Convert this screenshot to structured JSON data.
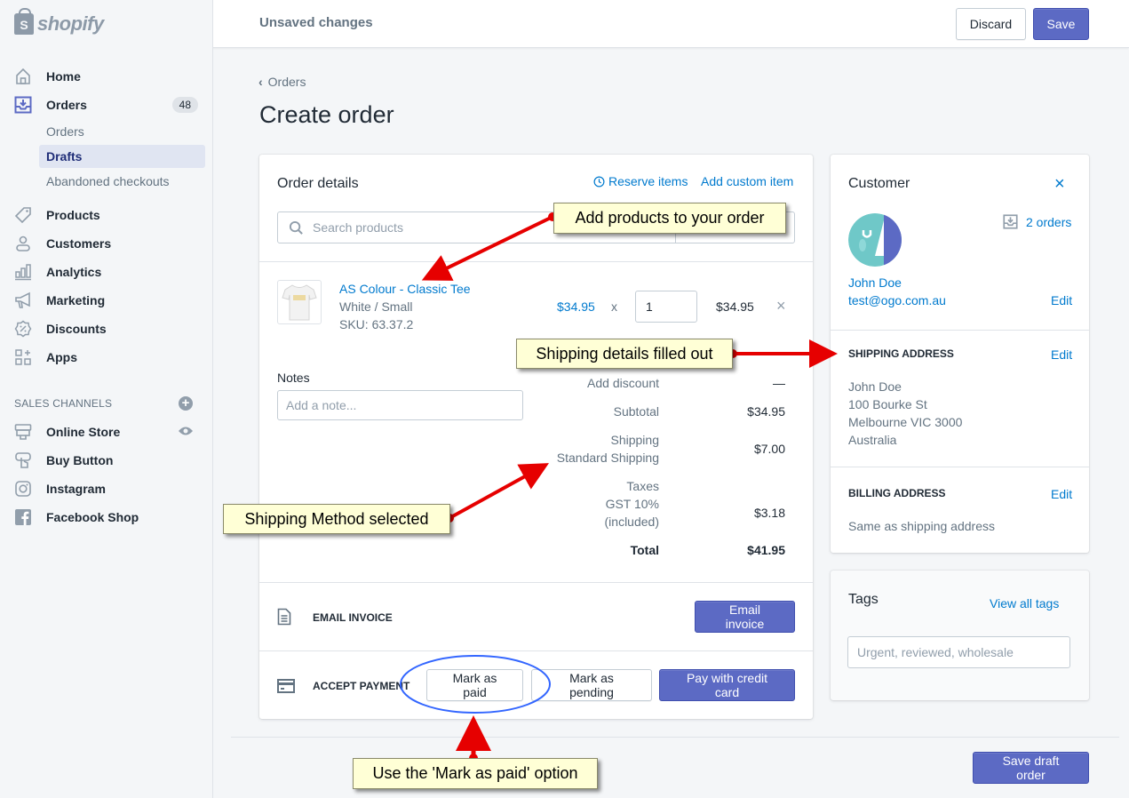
{
  "topbar": {
    "logo_text": "shopify",
    "status": "Unsaved changes",
    "discard_label": "Discard",
    "save_label": "Save"
  },
  "sidebar": {
    "items": [
      {
        "label": "Home",
        "icon": "home-icon"
      },
      {
        "label": "Orders",
        "icon": "orders-icon",
        "badge": "48"
      },
      {
        "label": "Products",
        "icon": "tag-icon"
      },
      {
        "label": "Customers",
        "icon": "person-icon"
      },
      {
        "label": "Analytics",
        "icon": "bar-chart-icon"
      },
      {
        "label": "Marketing",
        "icon": "megaphone-icon"
      },
      {
        "label": "Discounts",
        "icon": "discount-icon"
      },
      {
        "label": "Apps",
        "icon": "apps-icon"
      }
    ],
    "orders_sub": [
      "Orders",
      "Drafts",
      "Abandoned checkouts"
    ],
    "active_sub": "Drafts",
    "sales_channels_label": "SALES CHANNELS",
    "channels": [
      {
        "label": "Online Store",
        "icon": "store-icon"
      },
      {
        "label": "Buy Button",
        "icon": "buy-button-icon"
      },
      {
        "label": "Instagram",
        "icon": "instagram-icon"
      },
      {
        "label": "Facebook Shop",
        "icon": "facebook-icon"
      }
    ]
  },
  "main": {
    "breadcrumb": "Orders",
    "title": "Create order",
    "order_details": {
      "title": "Order details",
      "reserve_items": "Reserve items",
      "add_custom_item": "Add custom item",
      "search_placeholder": "Search products",
      "product": {
        "name": "AS Colour - Classic Tee",
        "variant": "White / Small",
        "sku": "SKU: 63.37.2",
        "price": "$34.95",
        "multiply": "x",
        "quantity": "1",
        "line_total": "$34.95"
      },
      "notes_label": "Notes",
      "notes_placeholder": "Add a note...",
      "summary": {
        "add_discount": "Add discount",
        "discount_value": "—",
        "subtotal_label": "Subtotal",
        "subtotal_value": "$34.95",
        "shipping_label": "Shipping",
        "shipping_method": "Standard Shipping",
        "shipping_value": "$7.00",
        "taxes_label": "Taxes",
        "tax_name": "GST 10%",
        "tax_note": "(included)",
        "tax_value": "$3.18",
        "total_label": "Total",
        "total_value": "$41.95"
      },
      "email_invoice_label": "EMAIL INVOICE",
      "email_invoice_button": "Email invoice",
      "accept_payment_label": "ACCEPT PAYMENT",
      "mark_paid_button": "Mark as paid",
      "mark_pending_button": "Mark as pending",
      "pay_card_button": "Pay with credit card"
    },
    "save_draft_button": "Save draft order"
  },
  "customer": {
    "title": "Customer",
    "orders_link": "2 orders",
    "name": "John Doe",
    "email": "test@ogo.com.au",
    "edit": "Edit",
    "shipping_title": "SHIPPING ADDRESS",
    "shipping_address": [
      "John Doe",
      "100 Bourke St",
      "Melbourne VIC 3000",
      "Australia"
    ],
    "billing_title": "BILLING ADDRESS",
    "billing_text": "Same as shipping address"
  },
  "tags": {
    "title": "Tags",
    "view_all": "View all tags",
    "placeholder": "Urgent, reviewed, wholesale"
  },
  "annotations": {
    "add_products": "Add products to your order",
    "shipping_details": "Shipping details filled out",
    "shipping_method": "Shipping Method selected",
    "mark_paid": "Use the 'Mark as paid' option"
  },
  "colors": {
    "primary": "#5c6ac4",
    "link": "#007ace",
    "callout_bg": "#ffffd6",
    "arrow": "#e60000",
    "highlight_ellipse": "#3366ff"
  }
}
